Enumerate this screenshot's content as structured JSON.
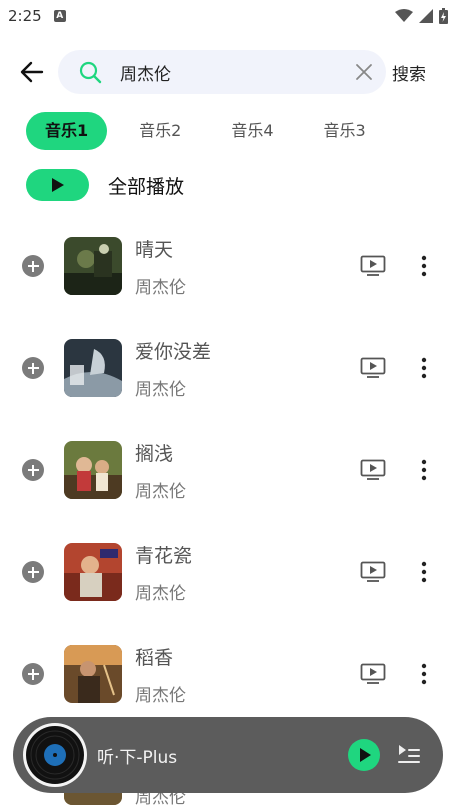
{
  "status": {
    "time": "2:25",
    "notification": "A"
  },
  "search": {
    "query": "周杰伦",
    "button_label": "搜索"
  },
  "tabs": [
    {
      "label": "音乐1",
      "active": true
    },
    {
      "label": "音乐2",
      "active": false
    },
    {
      "label": "音乐4",
      "active": false
    },
    {
      "label": "音乐3",
      "active": false
    }
  ],
  "play_all": {
    "label": "全部播放"
  },
  "songs": [
    {
      "title": "晴天",
      "artist": "周杰伦"
    },
    {
      "title": "爱你没差",
      "artist": "周杰伦"
    },
    {
      "title": "搁浅",
      "artist": "周杰伦"
    },
    {
      "title": "青花瓷",
      "artist": "周杰伦"
    },
    {
      "title": "稻香",
      "artist": "周杰伦"
    },
    {
      "title": "",
      "artist": "周杰伦"
    }
  ],
  "player": {
    "title": "听·下-Plus"
  },
  "colors": {
    "accent": "#1fd67f",
    "player_bg": "#5c5c5c",
    "search_bg": "#f1f3fb"
  }
}
